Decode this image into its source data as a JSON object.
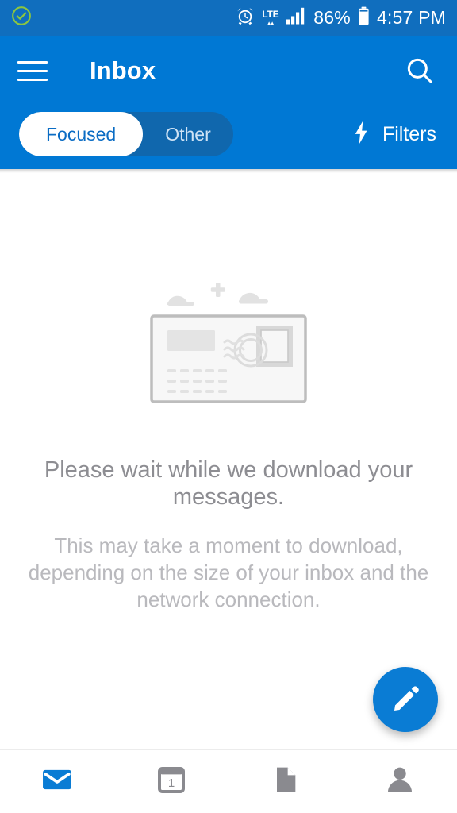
{
  "status_bar": {
    "notification_icon": "check-circle-icon",
    "alarm_icon": "alarm-clock-icon",
    "network_type": "LTE",
    "network_arrows": "▴▴",
    "signal_icon": "signal-bars-icon",
    "battery_percent": "86%",
    "battery_icon": "battery-icon",
    "time": "4:57 PM"
  },
  "app_bar": {
    "menu_icon": "hamburger-menu-icon",
    "title": "Inbox",
    "search_icon": "search-icon"
  },
  "pivot": {
    "tabs": [
      {
        "label": "Focused",
        "selected": true
      },
      {
        "label": "Other",
        "selected": false
      }
    ],
    "filters_label": "Filters",
    "filters_icon": "lightning-bolt-icon"
  },
  "empty_state": {
    "illustration": "envelope-postcard-illustration",
    "title": "Please wait while we download your messages.",
    "subtitle": "This may take a moment to download, depending on the size of your inbox and the network connection."
  },
  "fab": {
    "label": "compose-new-message",
    "icon": "pencil-edit-icon"
  },
  "bottom_nav": {
    "items": [
      {
        "name": "mail",
        "icon": "mail-envelope-icon",
        "active": true
      },
      {
        "name": "calendar",
        "icon": "calendar-icon",
        "day": "1",
        "active": false
      },
      {
        "name": "files",
        "icon": "file-document-icon",
        "active": false
      },
      {
        "name": "people",
        "icon": "person-icon",
        "active": false
      }
    ]
  },
  "colors": {
    "status_bar_blue": "#106ebe",
    "app_bar_blue": "#0078d4",
    "accent_blue": "#0a7cd4",
    "segment_track": "#1067ad",
    "title_gray": "#8d8d92",
    "subtitle_gray": "#b9b9bd",
    "illustration_gray": "#d2d2d2",
    "check_green": "#8cc63f",
    "nav_inactive_gray": "#8a8a8f"
  }
}
